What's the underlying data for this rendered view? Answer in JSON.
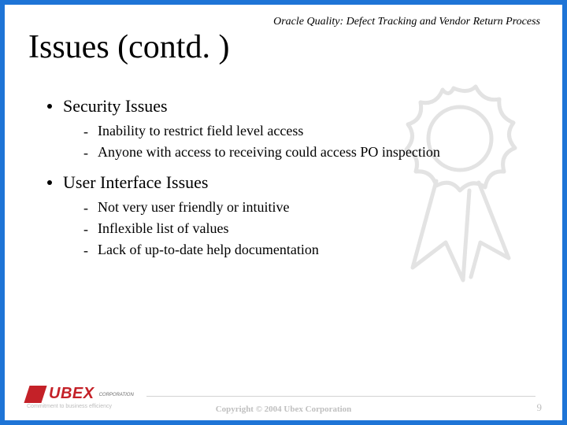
{
  "header_label": "Oracle Quality: Defect Tracking and Vendor Return Process",
  "title": "Issues (contd. )",
  "bullets": [
    {
      "label": "Security Issues",
      "items": [
        "Inability to restrict field level access",
        "Anyone with access to receiving could access PO inspection"
      ]
    },
    {
      "label": "User Interface Issues",
      "items": [
        "Not very user friendly or intuitive",
        "Inflexible list of values",
        "Lack of up-to-date help documentation"
      ]
    }
  ],
  "logo": {
    "name": "UBEX",
    "corp": "CORPORATION",
    "tagline": "Commitment to business efficiency"
  },
  "copyright": "Copyright © 2004 Ubex Corporation",
  "page_number": "9"
}
